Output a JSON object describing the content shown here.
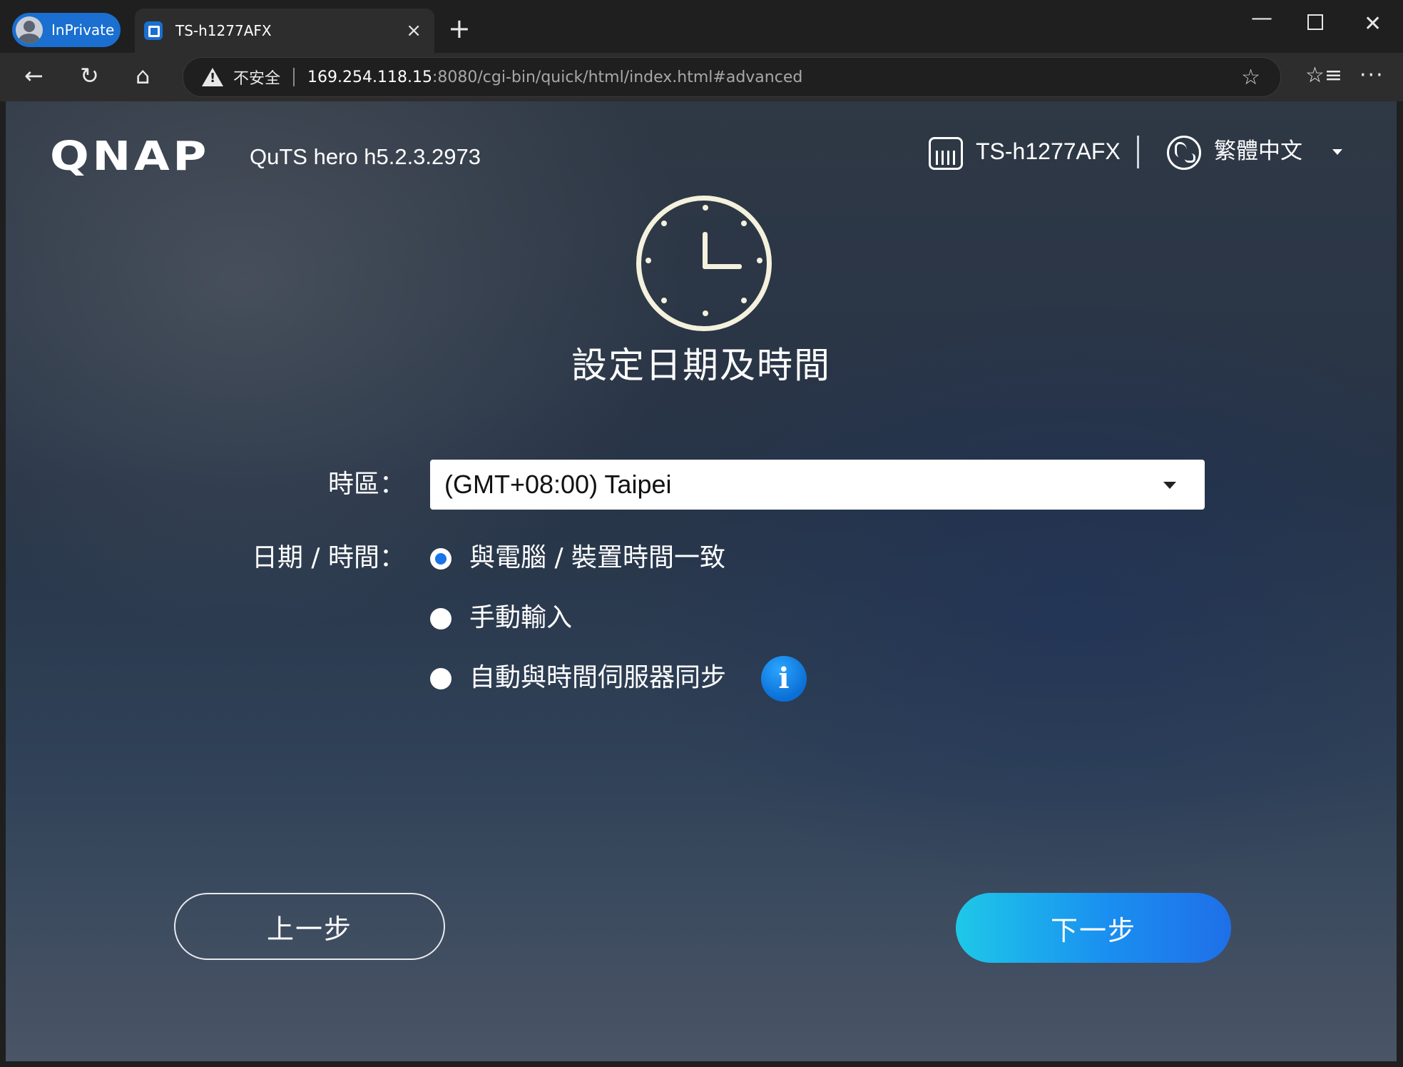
{
  "browser": {
    "inprivate_label": "InPrivate",
    "tab_title": "TS-h1277AFX",
    "tab_close": "×",
    "new_tab": "+",
    "security_label": "不安全",
    "url_host": "169.254.118.15",
    "url_path": ":8080/cgi-bin/quick/html/index.html#advanced",
    "window_controls": {
      "minimize": "—",
      "maximize": "",
      "close": "✕"
    },
    "toolbar": {
      "back": "←",
      "reload": "↻",
      "home": "⌂",
      "favorite": "☆",
      "favorites": "☆≡",
      "more": "···"
    }
  },
  "header": {
    "logo": "QNAP",
    "version": "QuTS hero h5.2.3.2973",
    "device_name": "TS-h1277AFX",
    "language": "繁體中文"
  },
  "main": {
    "title": "設定日期及時間",
    "timezone_label": "時區：",
    "timezone_value": "(GMT+08:00) Taipei",
    "datetime_label": "日期 / 時間：",
    "options": [
      {
        "label": "與電腦 / 裝置時間一致",
        "checked": true
      },
      {
        "label": "手動輸入",
        "checked": false
      },
      {
        "label": "自動與時間伺服器同步",
        "checked": false
      }
    ],
    "info_glyph": "i"
  },
  "footer": {
    "prev_label": "上一步",
    "next_label": "下一步"
  },
  "colors": {
    "accent": "#1a73e8",
    "inprivate": "#1a6fd0",
    "next_gradient_start": "#1ec8e8",
    "next_gradient_end": "#1f6fe8"
  }
}
